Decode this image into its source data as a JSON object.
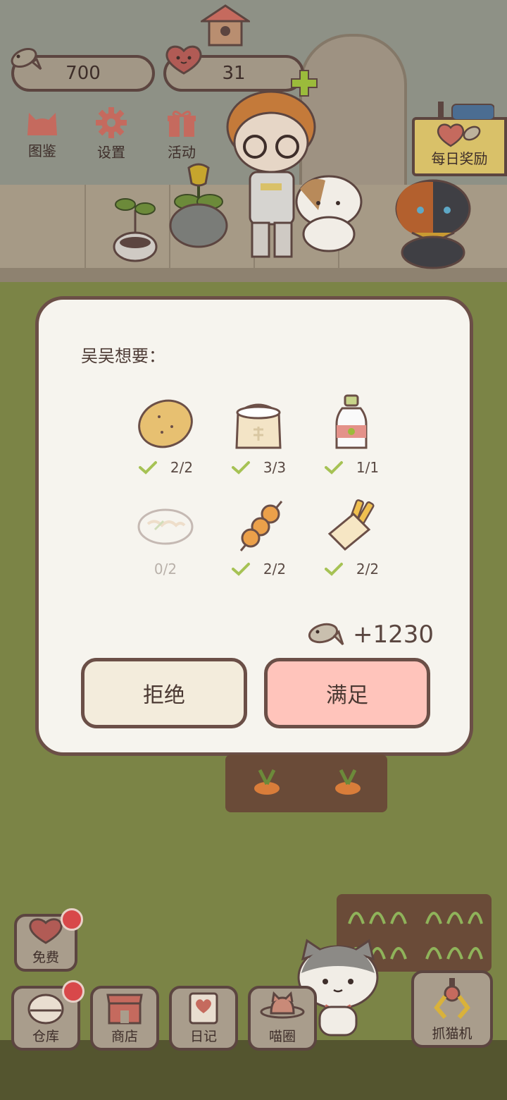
{
  "currency": {
    "fish_amount": "700",
    "heart_amount": "31"
  },
  "top_menu": {
    "guide_label": "图鉴",
    "settings_label": "设置",
    "events_label": "活动"
  },
  "daily_reward": {
    "label": "每日奖励"
  },
  "request_dialog": {
    "title": "吴吴想要：",
    "items": [
      {
        "icon": "potato-icon",
        "count": "2/2",
        "done": true
      },
      {
        "icon": "flour-sack-icon",
        "count": "3/3",
        "done": true
      },
      {
        "icon": "milk-bottle-icon",
        "count": "1/1",
        "done": true
      },
      {
        "icon": "noodle-plate-icon",
        "count": "0/2",
        "done": false
      },
      {
        "icon": "skewer-icon",
        "count": "2/2",
        "done": true
      },
      {
        "icon": "fries-icon",
        "count": "2/2",
        "done": true
      }
    ],
    "reward": "+1230",
    "refuse_label": "拒绝",
    "satisfy_label": "满足"
  },
  "bottom_bar": {
    "free_label": "免费",
    "warehouse_label": "仓库",
    "shop_label": "商店",
    "diary_label": "日记",
    "meow_circle_label": "喵圈",
    "claw_machine_label": "抓猫机"
  },
  "colors": {
    "accent_pink": "#ffc4bb",
    "check_green": "#a6c254",
    "border_brown": "#6b4f47",
    "badge_red": "#d8484a"
  }
}
